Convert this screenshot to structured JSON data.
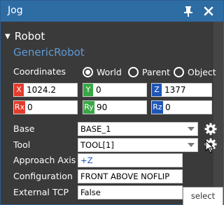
{
  "window": {
    "title": "Jog"
  },
  "robot": {
    "section_label": "Robot",
    "name": "GenericRobot"
  },
  "coordinates": {
    "label": "Coordinates",
    "options": [
      {
        "label": "World",
        "selected": true
      },
      {
        "label": "Parent",
        "selected": false
      },
      {
        "label": "Object",
        "selected": false
      }
    ]
  },
  "position": {
    "x": {
      "tag": "X",
      "value": "1024.2",
      "color": "#e53b2c"
    },
    "y": {
      "tag": "Y",
      "value": "0",
      "color": "#3aa845"
    },
    "z": {
      "tag": "Z",
      "value": "1377",
      "color": "#1e56b8"
    }
  },
  "rotation": {
    "rx": {
      "tag": "Rx",
      "value": "0",
      "color": "#e53b2c"
    },
    "ry": {
      "tag": "Ry",
      "value": "90",
      "color": "#3aa845"
    },
    "rz": {
      "tag": "Rz",
      "value": "0",
      "color": "#1e56b8"
    }
  },
  "fields": {
    "base": {
      "label": "Base",
      "value": "BASE_1"
    },
    "tool": {
      "label": "Tool",
      "value": "TOOL[1]"
    },
    "approach_axis": {
      "label": "Approach Axis",
      "value": "+Z"
    },
    "configuration": {
      "label": "Configuration",
      "value": "FRONT ABOVE NOFLIP"
    },
    "external_tcp": {
      "label": "External TCP",
      "value": "False"
    }
  },
  "tooltip": {
    "text": "select"
  },
  "icons": [
    "pin-icon",
    "close-icon",
    "gear-icon",
    "mouse-cursor-icon"
  ],
  "colors": {
    "titlebar": "#2e6ca4",
    "panel": "#3a3a3a",
    "accent_text": "#5f9ad6"
  }
}
